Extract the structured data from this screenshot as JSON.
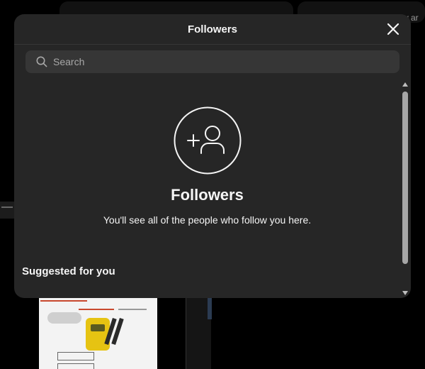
{
  "dialog": {
    "title": "Followers",
    "close_icon": "close-icon"
  },
  "search": {
    "placeholder": "Search",
    "value": "",
    "icon": "search-icon"
  },
  "empty_state": {
    "icon": "add-user-icon",
    "title": "Followers",
    "subtitle": "You'll see all of the people who follow you here."
  },
  "suggested": {
    "heading": "Suggested for you"
  },
  "background": {
    "partial_text": "w ar"
  },
  "colors": {
    "dialog_bg": "#262626",
    "search_bg": "#363636",
    "text_primary": "#f5f5f5",
    "text_secondary": "#a8a8a8",
    "backdrop": "#000000"
  }
}
